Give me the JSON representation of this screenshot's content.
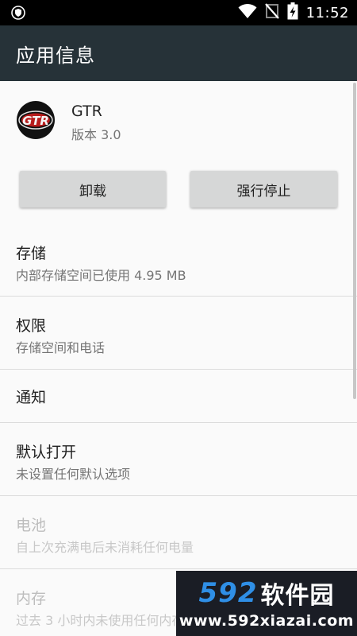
{
  "status_bar": {
    "time": "11:52",
    "icons": [
      "shield-notification-icon",
      "wifi-icon",
      "no-sim-icon",
      "battery-charging-icon"
    ]
  },
  "app_bar": {
    "title": "应用信息"
  },
  "app": {
    "name": "GTR",
    "version": "版本 3.0",
    "icon": "gtr-logo-icon",
    "icon_text": "GTR"
  },
  "buttons": {
    "uninstall": "卸载",
    "force_stop": "强行停止"
  },
  "settings": [
    {
      "title": "存储",
      "subtitle": "内部存储空间已使用 4.95 MB",
      "enabled": true
    },
    {
      "title": "权限",
      "subtitle": "存储空间和电话",
      "enabled": true
    },
    {
      "title": "通知",
      "subtitle": "",
      "enabled": true
    },
    {
      "title": "默认打开",
      "subtitle": "未设置任何默认选项",
      "enabled": true
    },
    {
      "title": "电池",
      "subtitle": "自上次充满电后未消耗任何电量",
      "enabled": false
    },
    {
      "title": "内存",
      "subtitle": "过去 3 小时内未使用任何内存",
      "enabled": false
    }
  ],
  "watermark": {
    "logo_number": "592",
    "logo_text": "软件园",
    "url": "www.592xiazai.com"
  },
  "colors": {
    "status_bar": "#000000",
    "app_bar": "#263238",
    "background": "#fafafa",
    "button": "#d6d7d7",
    "primary_text": "#212121",
    "secondary_text": "#757575",
    "disabled_text": "#bdbdbd"
  }
}
